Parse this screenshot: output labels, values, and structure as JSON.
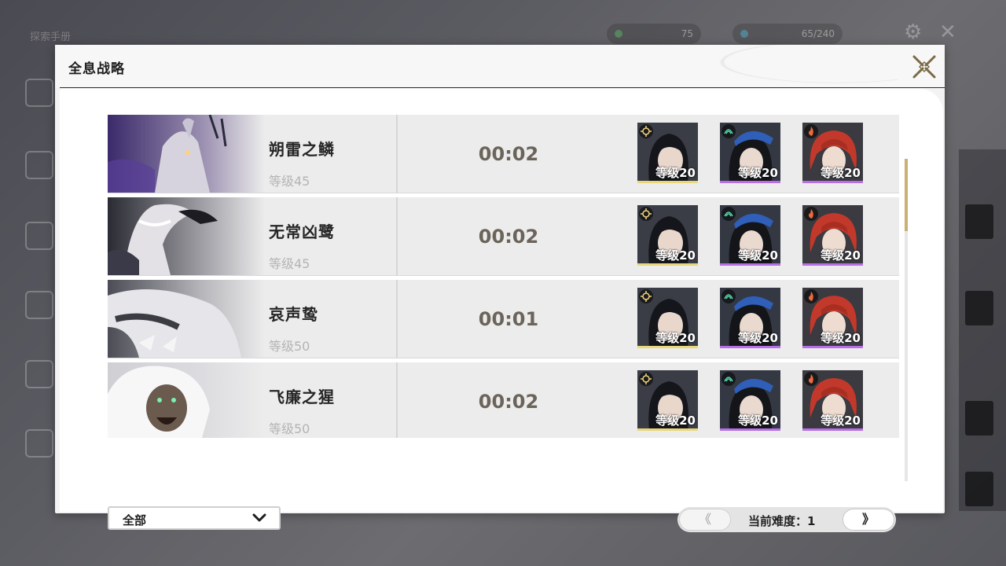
{
  "background": {
    "title": "探索手册",
    "stamina": "75",
    "currency": "65/240"
  },
  "panel": {
    "title": "全息战略"
  },
  "rows": [
    {
      "name": "朔雷之鳞",
      "level": "等级45",
      "time": "00:02",
      "characters": [
        {
          "level": "等级20",
          "element": "spectro",
          "rarity_color": "#e8d87a"
        },
        {
          "level": "等级20",
          "element": "aero",
          "rarity_color": "#b86fe6"
        },
        {
          "level": "等级20",
          "element": "fusion",
          "rarity_color": "#b86fe6"
        }
      ]
    },
    {
      "name": "无常凶鹭",
      "level": "等级45",
      "time": "00:02",
      "characters": [
        {
          "level": "等级20",
          "element": "spectro",
          "rarity_color": "#e8d87a"
        },
        {
          "level": "等级20",
          "element": "aero",
          "rarity_color": "#b86fe6"
        },
        {
          "level": "等级20",
          "element": "fusion",
          "rarity_color": "#b86fe6"
        }
      ]
    },
    {
      "name": "哀声鸷",
      "level": "等级50",
      "time": "00:01",
      "characters": [
        {
          "level": "等级20",
          "element": "spectro",
          "rarity_color": "#e8d87a"
        },
        {
          "level": "等级20",
          "element": "aero",
          "rarity_color": "#b86fe6"
        },
        {
          "level": "等级20",
          "element": "fusion",
          "rarity_color": "#b86fe6"
        }
      ]
    },
    {
      "name": "飞廉之猩",
      "level": "等级50",
      "time": "00:02",
      "characters": [
        {
          "level": "等级20",
          "element": "spectro",
          "rarity_color": "#e8d87a"
        },
        {
          "level": "等级20",
          "element": "aero",
          "rarity_color": "#b86fe6"
        },
        {
          "level": "等级20",
          "element": "fusion",
          "rarity_color": "#b86fe6"
        }
      ]
    }
  ],
  "filter": {
    "selected": "全部"
  },
  "pager": {
    "prev": "《",
    "label": "当前难度：",
    "difficulty": "1",
    "next": "》"
  },
  "icons": {
    "close": "close-icon",
    "dropdown": "chevron-down-icon"
  },
  "colors": {
    "accent_gold": "#c9b176",
    "panel_bg": "#f3f3f3",
    "time_text": "#6b645a"
  }
}
